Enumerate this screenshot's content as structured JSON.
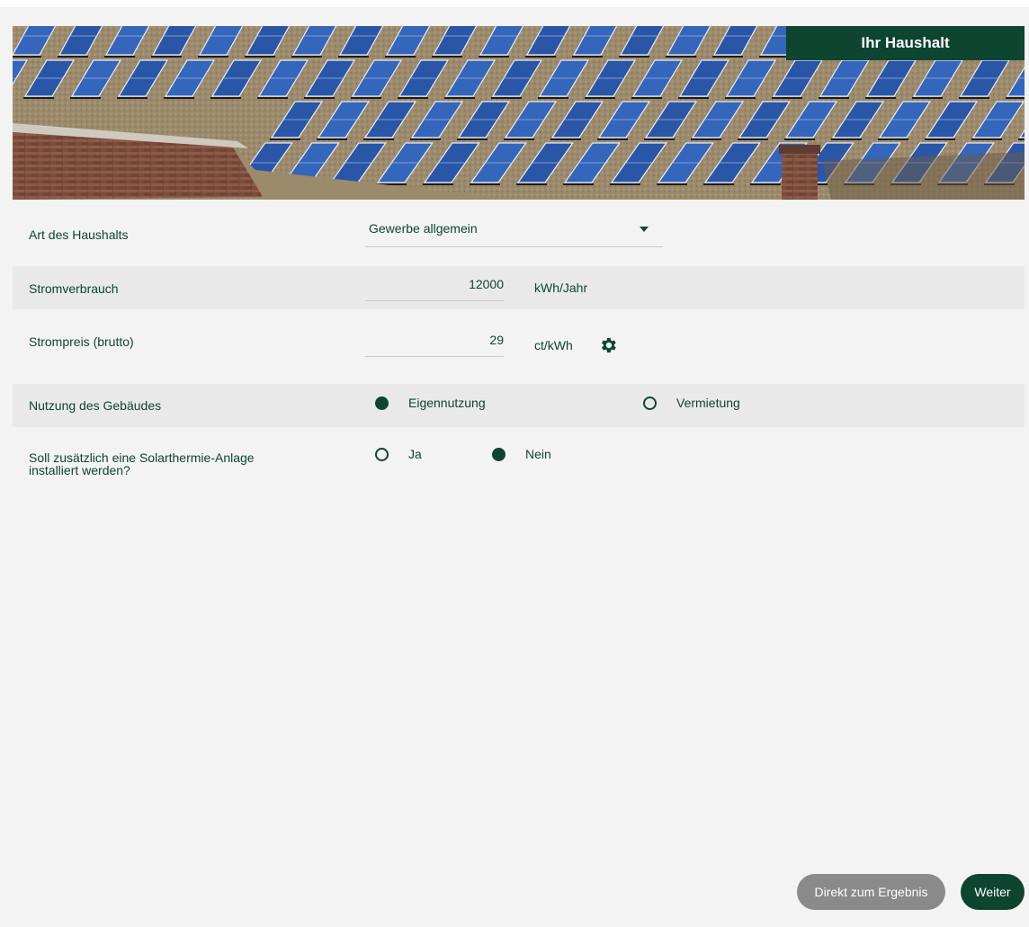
{
  "header": {
    "title": "Ihr Haushalt"
  },
  "colors": {
    "brand": "#0d4531",
    "secondary_button": "#8a8a8a",
    "row_shade": "#e9e9e9"
  },
  "form": {
    "household_type": {
      "label": "Art des Haushalts",
      "selected": "Gewerbe allgemein"
    },
    "consumption": {
      "label": "Stromverbrauch",
      "value": "12000",
      "unit": "kWh/Jahr"
    },
    "price": {
      "label": "Strompreis (brutto)",
      "value": "29",
      "unit": "ct/kWh",
      "icon": "gear-icon"
    },
    "usage": {
      "label": "Nutzung des Gebäudes",
      "options": [
        {
          "label": "Eigennutzung",
          "selected": true
        },
        {
          "label": "Vermietung",
          "selected": false
        }
      ]
    },
    "solarthermie": {
      "label_line1": "Soll zusätzlich eine Solarthermie-Anlage",
      "label_line2": "installiert werden?",
      "options": [
        {
          "label": "Ja",
          "selected": false
        },
        {
          "label": "Nein",
          "selected": true
        }
      ]
    }
  },
  "footer": {
    "result_button": "Direkt zum Ergebnis",
    "next_button": "Weiter"
  }
}
